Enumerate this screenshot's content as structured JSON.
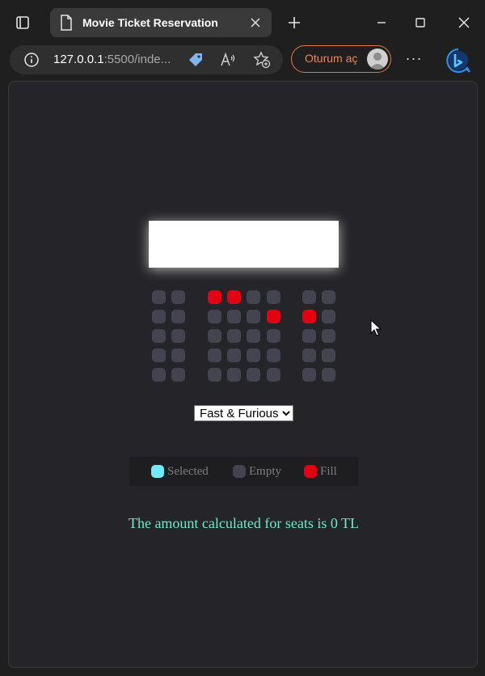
{
  "browser": {
    "tab_title": "Movie Ticket Reservation",
    "url_host": "127.0.0.1",
    "url_rest": ":5500/inde...",
    "signin_label": "Oturum aç",
    "more_label": "···"
  },
  "app": {
    "movie_options": [
      "Fast & Furious"
    ],
    "selected_movie": "Fast & Furious",
    "legend": {
      "selected": "Selected",
      "empty": "Empty",
      "fill": "Fill"
    },
    "amount_text": "The amount calculated for seats is 0 TL",
    "colors": {
      "selected": "#6feaf6",
      "empty": "#444451",
      "fill": "#e40013",
      "amount_text": "#6feac8"
    },
    "seat_rows": [
      [
        "empty",
        "empty",
        "fill",
        "fill",
        "empty",
        "empty",
        "empty",
        "empty"
      ],
      [
        "empty",
        "empty",
        "empty",
        "empty",
        "empty",
        "fill",
        "fill",
        "empty"
      ],
      [
        "empty",
        "empty",
        "empty",
        "empty",
        "empty",
        "empty",
        "empty",
        "empty"
      ],
      [
        "empty",
        "empty",
        "empty",
        "empty",
        "empty",
        "empty",
        "empty",
        "empty"
      ],
      [
        "empty",
        "empty",
        "empty",
        "empty",
        "empty",
        "empty",
        "empty",
        "empty"
      ]
    ]
  }
}
